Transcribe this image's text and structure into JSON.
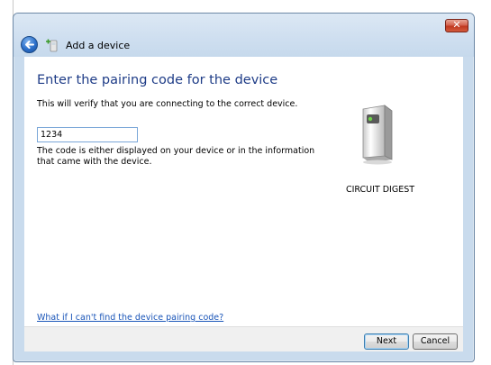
{
  "window": {
    "title": "Add a device",
    "close_glyph": "✕",
    "back_icon": "back-arrow-icon",
    "title_icon": "add-device-icon"
  },
  "main": {
    "heading": "Enter the pairing code for the device",
    "description": "This will verify that you are connecting to the correct device.",
    "code_value": "1234",
    "hint": "The code is either displayed on your device or in the information that came with the device.",
    "device_label": "CIRCUIT DIGEST",
    "device_icon": "device-tower-icon",
    "help_link": "What if I can't find the device pairing code?"
  },
  "footer": {
    "next_label": "Next",
    "cancel_label": "Cancel"
  },
  "colors": {
    "heading": "#1e3c87",
    "link": "#1a55b8",
    "frame": "#c9dbed",
    "close": "#c0381f"
  }
}
